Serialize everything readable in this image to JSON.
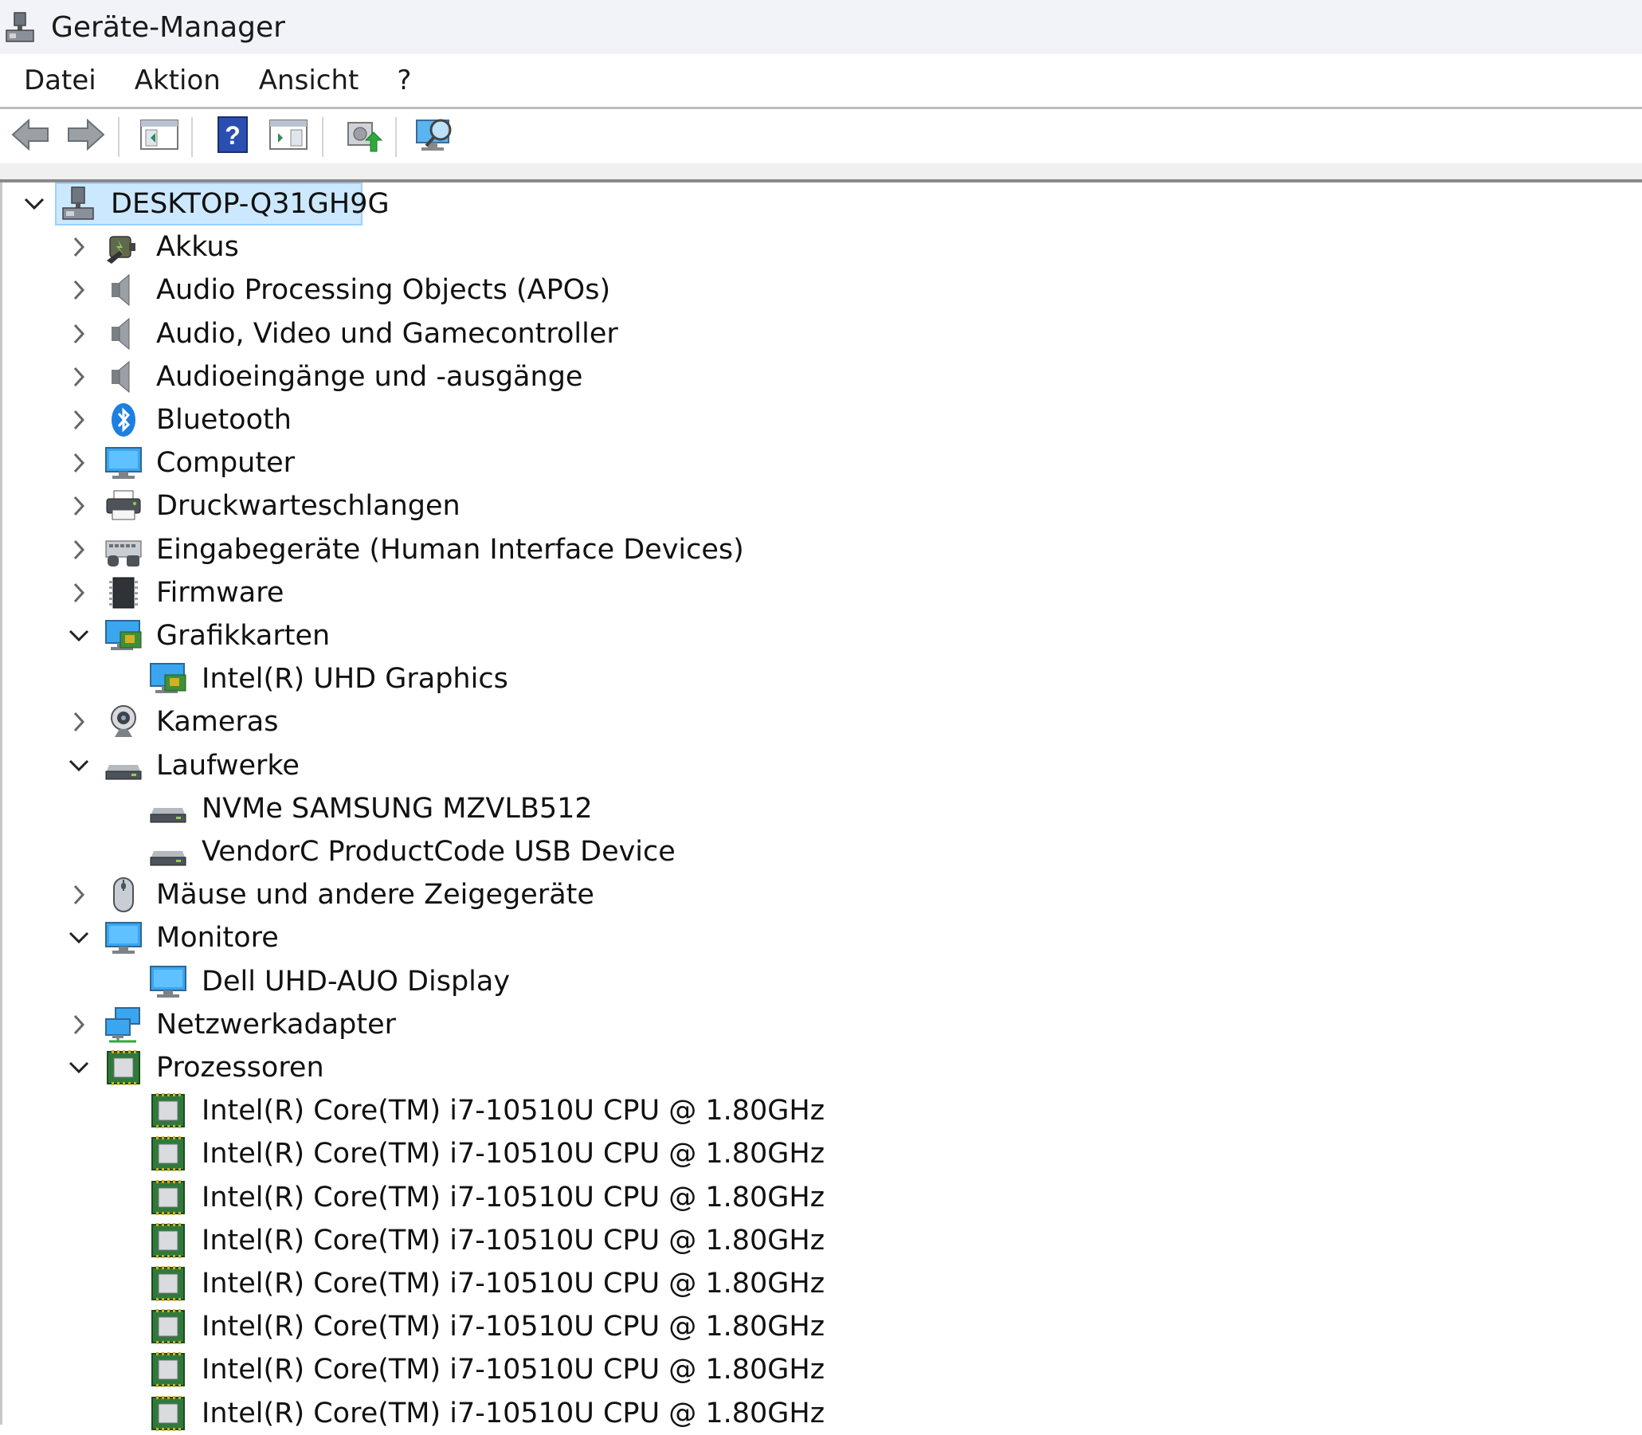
{
  "window": {
    "title": "Geräte-Manager",
    "icon": "device-manager-icon"
  },
  "menu": {
    "items": [
      "Datei",
      "Aktion",
      "Ansicht",
      "?"
    ]
  },
  "toolbar": {
    "buttons": [
      "back-icon",
      "forward-icon",
      "show-hide-console-tree-icon",
      "help-icon",
      "show-action-pane-icon",
      "update-driver-icon",
      "scan-hardware-icon"
    ]
  },
  "tree": {
    "root": {
      "label": "DESKTOP-Q31GH9G",
      "expanded": true,
      "selected": true,
      "icon": "computer-icon"
    },
    "nodes": [
      {
        "label": "Akkus",
        "expanded": false,
        "icon": "battery-icon",
        "children": []
      },
      {
        "label": "Audio Processing Objects (APOs)",
        "expanded": false,
        "icon": "speaker-icon",
        "children": []
      },
      {
        "label": "Audio, Video und Gamecontroller",
        "expanded": false,
        "icon": "speaker-icon",
        "children": []
      },
      {
        "label": "Audioeingänge und -ausgänge",
        "expanded": false,
        "icon": "speaker-icon",
        "children": []
      },
      {
        "label": "Bluetooth",
        "expanded": false,
        "icon": "bluetooth-icon",
        "children": []
      },
      {
        "label": "Computer",
        "expanded": false,
        "icon": "monitor-icon",
        "children": []
      },
      {
        "label": "Druckwarteschlangen",
        "expanded": false,
        "icon": "printer-icon",
        "children": []
      },
      {
        "label": "Eingabegeräte (Human Interface Devices)",
        "expanded": false,
        "icon": "hid-icon",
        "children": []
      },
      {
        "label": "Firmware",
        "expanded": false,
        "icon": "firmware-icon",
        "children": []
      },
      {
        "label": "Grafikkarten",
        "expanded": true,
        "icon": "display-adapter-icon",
        "children": [
          {
            "label": "Intel(R) UHD Graphics",
            "icon": "display-adapter-icon"
          }
        ]
      },
      {
        "label": "Kameras",
        "expanded": false,
        "icon": "webcam-icon",
        "children": []
      },
      {
        "label": "Laufwerke",
        "expanded": true,
        "icon": "drive-icon",
        "children": [
          {
            "label": "NVMe SAMSUNG MZVLB512",
            "icon": "drive-icon"
          },
          {
            "label": "VendorC ProductCode USB Device",
            "icon": "drive-icon"
          }
        ]
      },
      {
        "label": "Mäuse und andere Zeigegeräte",
        "expanded": false,
        "icon": "mouse-icon",
        "children": []
      },
      {
        "label": "Monitore",
        "expanded": true,
        "icon": "monitor-icon",
        "children": [
          {
            "label": "Dell UHD-AUO Display",
            "icon": "monitor-icon"
          }
        ]
      },
      {
        "label": "Netzwerkadapter",
        "expanded": false,
        "icon": "network-adapter-icon",
        "children": []
      },
      {
        "label": "Prozessoren",
        "expanded": true,
        "icon": "processor-icon",
        "children": [
          {
            "label": "Intel(R) Core(TM) i7-10510U CPU @ 1.80GHz",
            "icon": "processor-icon"
          },
          {
            "label": "Intel(R) Core(TM) i7-10510U CPU @ 1.80GHz",
            "icon": "processor-icon"
          },
          {
            "label": "Intel(R) Core(TM) i7-10510U CPU @ 1.80GHz",
            "icon": "processor-icon"
          },
          {
            "label": "Intel(R) Core(TM) i7-10510U CPU @ 1.80GHz",
            "icon": "processor-icon"
          },
          {
            "label": "Intel(R) Core(TM) i7-10510U CPU @ 1.80GHz",
            "icon": "processor-icon"
          },
          {
            "label": "Intel(R) Core(TM) i7-10510U CPU @ 1.80GHz",
            "icon": "processor-icon"
          },
          {
            "label": "Intel(R) Core(TM) i7-10510U CPU @ 1.80GHz",
            "icon": "processor-icon"
          },
          {
            "label": "Intel(R) Core(TM) i7-10510U CPU @ 1.80GHz",
            "icon": "processor-icon"
          }
        ]
      }
    ]
  }
}
